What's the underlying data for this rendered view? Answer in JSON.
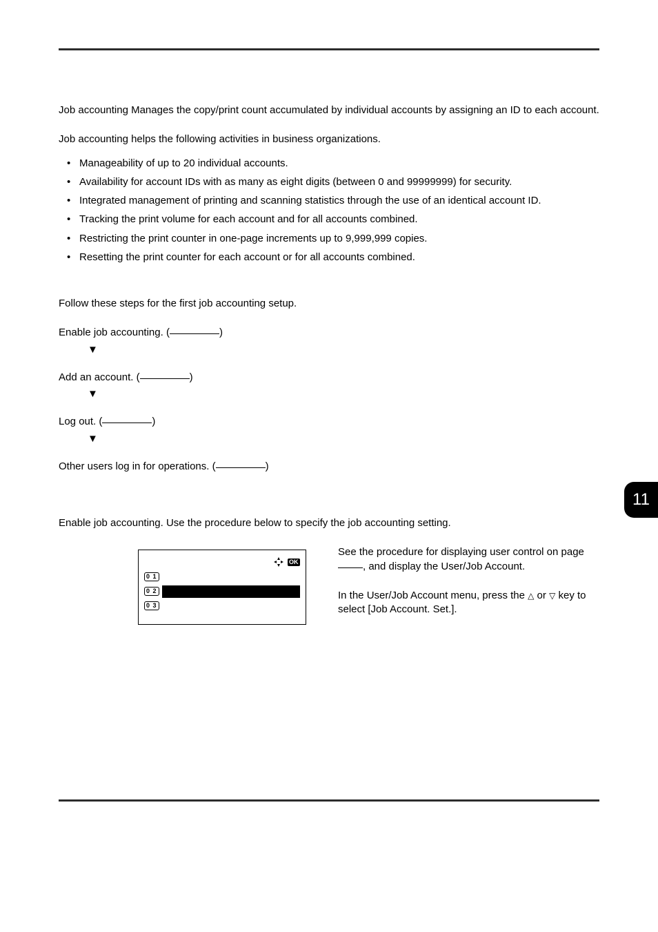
{
  "page_tab": "11",
  "intro": {
    "p1": "Job accounting Manages the copy/print count accumulated by individual accounts by assigning an ID to each account.",
    "p2": "Job accounting helps the following activities in business organizations."
  },
  "bullets": [
    "Manageability of up to 20 individual accounts.",
    "Availability for account IDs with as many as eight digits (between 0 and 99999999) for security.",
    "Integrated management of printing and scanning statistics through the use of an identical account ID.",
    "Tracking the print volume for each account and for all accounts combined.",
    "Restricting the print counter in one-page increments up to 9,999,999 copies.",
    "Resetting the print counter for each account or for all accounts combined."
  ],
  "flow": {
    "lead": "Follow these steps for the first job accounting setup.",
    "steps": [
      "Enable job accounting. (",
      "Add an account. (",
      "Log out. (",
      "Other users log in for operations. ("
    ],
    "close_paren": ")"
  },
  "section2": {
    "p1": "Enable job accounting. Use the procedure below to specify the job accounting setting.",
    "r1a": "See the procedure for displaying user control on page ",
    "r1b": ", and display the User/Job Account.",
    "r2a": "In the User/Job Account menu, press the ",
    "r2b": " or ",
    "r2c": " key to select [Job Account. Set.]."
  },
  "panel": {
    "icons": {
      "nav": "✦",
      "ok": "OK"
    },
    "rows": [
      {
        "num": "0 1",
        "label": ""
      },
      {
        "num": "0 2",
        "label": "",
        "highlight": true
      },
      {
        "num": "0 3",
        "label": ""
      }
    ]
  }
}
